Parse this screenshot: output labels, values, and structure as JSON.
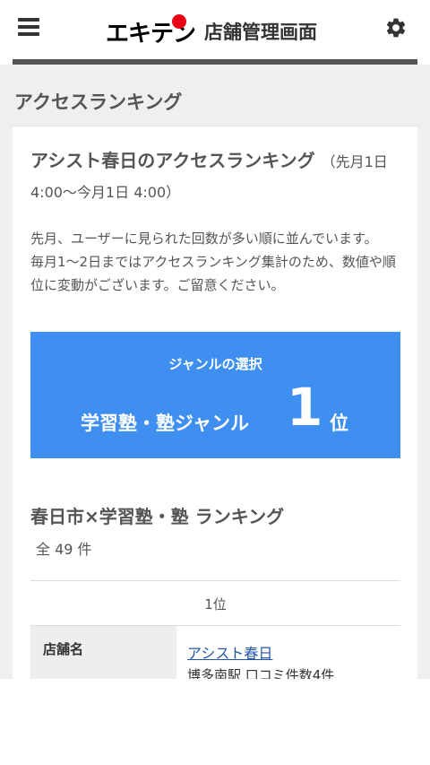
{
  "header": {
    "logo_text": "エキテン",
    "subtitle": "店舗管理画面",
    "menu_icon": "hamburger-menu-icon",
    "settings_icon": "gear-icon",
    "brand_red": "#e60012"
  },
  "page": {
    "section_title": "アクセスランキング"
  },
  "card": {
    "title": "アシスト春日のアクセスランキング",
    "period": "（先月1日 4:00〜今月1日 4:00）",
    "description_1": "先月、ユーザーに見られた回数が多い順に並んでいます。",
    "description_2": "毎月1〜2日まではアクセスランキング集計のため、数値や順位に変動がございます。ご留意ください。"
  },
  "genre": {
    "label": "ジャンルの選択",
    "name": "学習塾・塾ジャンル",
    "rank": "1",
    "rank_unit": "位",
    "accent": "#3e8ff0"
  },
  "ranking": {
    "title": "春日市×学習塾・塾 ランキング",
    "total": "全 49 件",
    "entries": [
      {
        "rank": "1位",
        "header": "店舗名",
        "store_name": "アシスト春日",
        "station_reviews": "博多南駅 口コミ件数4件"
      }
    ]
  }
}
